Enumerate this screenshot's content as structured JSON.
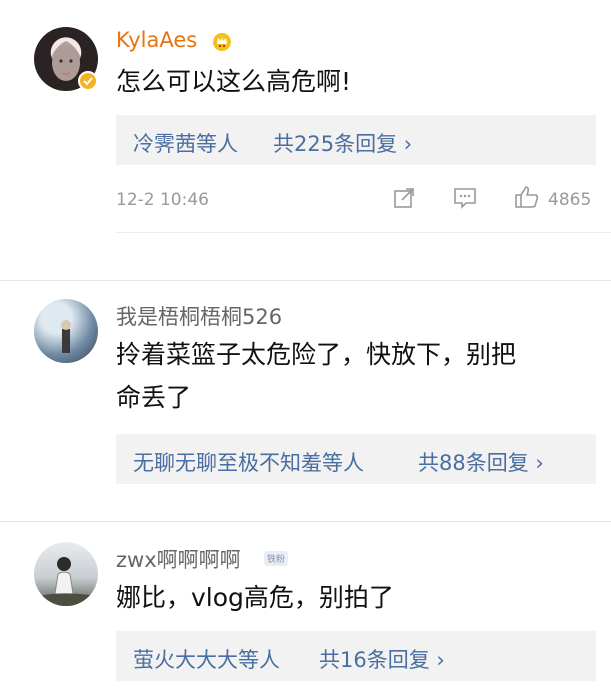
{
  "comments": [
    {
      "username": "KylaAes",
      "badge": "vip-crown-icon",
      "content": "怎么可以这么高危啊!",
      "reply_summary": {
        "names": "冷霁茜等人",
        "count": "共225条回复 ›"
      },
      "time": "12-2 10:46",
      "likes": "4865"
    },
    {
      "username": "我是梧桐梧桐526",
      "content_line1": "拎着菜篮子太危险了，快放下，别把",
      "content_line2": "命丢了",
      "reply_summary": {
        "names": "无聊无聊至极不知羞等人",
        "count": "共88条回复 ›"
      }
    },
    {
      "username": "zwx啊啊啊啊",
      "badge_text": "铁粉",
      "content": "娜比，vlog高危，别拍了",
      "reply_summary": {
        "names": "萤火大大大等人",
        "count": "共16条回复 ›"
      }
    }
  ],
  "colors": {
    "link": "#4a6ea0",
    "vip_name": "#e8740c",
    "reply_bg": "#f2f2f2",
    "meta": "#999999"
  }
}
